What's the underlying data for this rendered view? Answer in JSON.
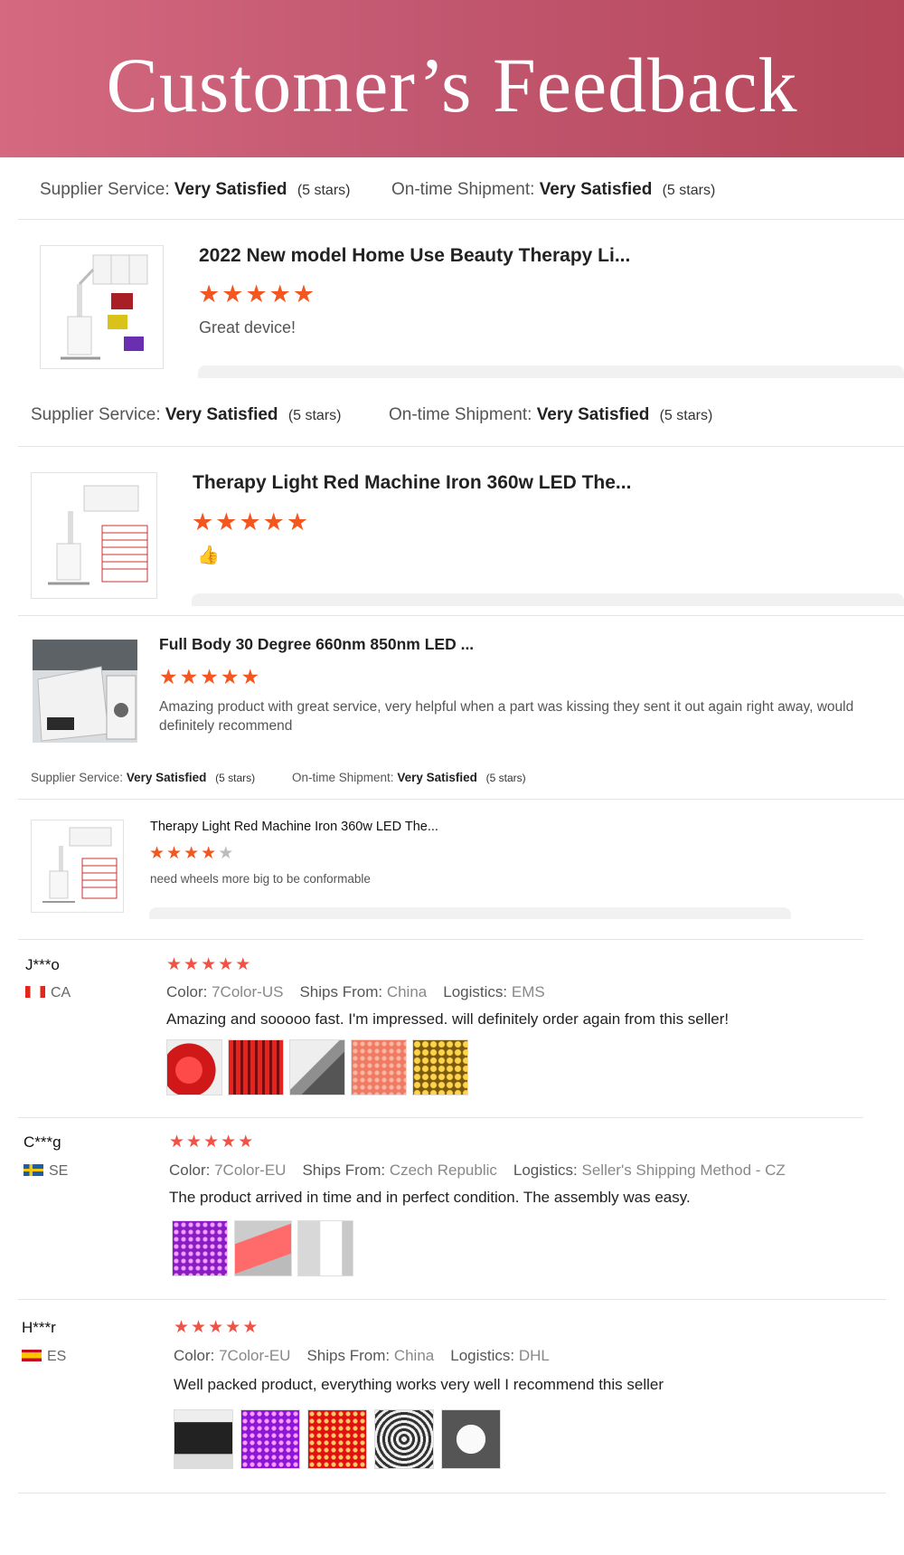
{
  "banner": {
    "title": "Customer’s Feedback"
  },
  "labels": {
    "supplier": "Supplier Service:",
    "shipment": "On-time Shipment:",
    "color": "Color:",
    "ships_from": "Ships From:",
    "logistics": "Logistics:"
  },
  "ratings": {
    "very_satisfied": "Very Satisfied",
    "five_stars": "(5 stars)"
  },
  "products": [
    {
      "title": "2022 New model Home Use Beauty Therapy Li...",
      "rating": 5,
      "text": "Great device!"
    },
    {
      "title": "Therapy Light Red Machine Iron 360w LED The...",
      "rating": 5,
      "text": "👍"
    },
    {
      "title": "Full Body 30 Degree 660nm 850nm LED ...",
      "rating": 5,
      "text": "Amazing product with great service, very helpful when a part was kissing they sent it out again right away, would definitely recommend"
    },
    {
      "title": "Therapy Light Red Machine Iron 360w LED The...",
      "rating": 4,
      "text": "need wheels more big to be conformable"
    }
  ],
  "reviews": [
    {
      "user": "J***o",
      "country": "CA",
      "rating": 5,
      "color": "7Color-US",
      "ships_from": "China",
      "logistics": "EMS",
      "text": "Amazing and sooooo fast. I'm impressed. will definitely order again from this seller!",
      "photo_count": 5
    },
    {
      "user": "C***g",
      "country": "SE",
      "rating": 5,
      "color": "7Color-EU",
      "ships_from": "Czech Republic",
      "logistics": "Seller's Shipping Method - CZ",
      "text": "The product arrived in time and in perfect condition. The assembly was easy.",
      "photo_count": 3
    },
    {
      "user": "H***r",
      "country": "ES",
      "rating": 5,
      "color": "7Color-EU",
      "ships_from": "China",
      "logistics": "DHL",
      "text": "Well packed product, everything works very well I recommend this seller",
      "photo_count": 5
    }
  ],
  "colors": {
    "banner_start": "#d4697f",
    "banner_end": "#b54659",
    "star_orange": "#f3561e",
    "star_red": "#f05246"
  },
  "icons": {
    "star": "star-icon",
    "thumb": "thumbs-up-icon"
  }
}
